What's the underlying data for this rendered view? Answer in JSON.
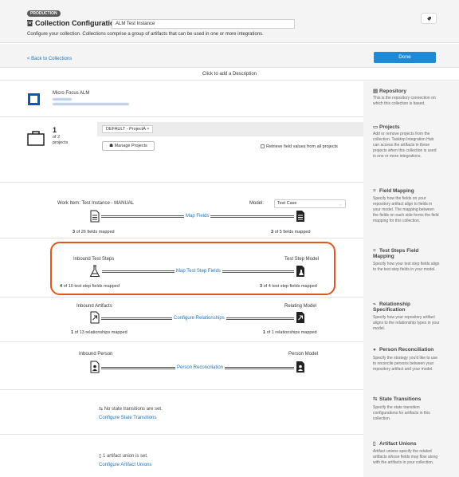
{
  "header": {
    "badge": "PRODUCTION",
    "title": "Collection Configuration",
    "name_value": "ALM Test Instance",
    "subtitle": "Configure your collection. Collections comprise a group of artifacts that can be used in one or more integrations."
  },
  "nav": {
    "back": "< Back to Collections",
    "done": "Done"
  },
  "description": "Click to add a Description",
  "repository": {
    "name": "Micro Focus ALM"
  },
  "projects": {
    "count": "1",
    "of": "of 2",
    "label": "projects",
    "tag": "DEFAULT - ProjectA  ×",
    "manage": "Manage Projects",
    "retrieve": "Retrieve field values from all projects"
  },
  "field_mapping": {
    "left_label": "Work Item: Test Instance - MANUAL",
    "model_label": "Model:",
    "model_value": "Test Case",
    "link": "Map Fields",
    "left_count": "3",
    "left_text": "of 26 fields mapped",
    "right_count": "3",
    "right_text": "of 5 fields mapped"
  },
  "test_steps": {
    "left_label": "Inbound Test Steps",
    "right_label": "Test Step Model",
    "link": "Map Test Step Fields",
    "left_count": "4",
    "left_text": "of 10 test step fields mapped",
    "right_count": "3",
    "right_text": "of 4 test step fields mapped"
  },
  "relationships": {
    "left_label": "Inbound Artifacts",
    "right_label": "Relating Model",
    "link": "Configure Relationships",
    "left_count": "1",
    "left_text": "of 13 relationships mapped",
    "right_count": "1",
    "right_text": "of 1 relationships mapped"
  },
  "person": {
    "left_label": "Inbound Person",
    "right_label": "Person Model",
    "link": "Person Reconciliation"
  },
  "state": {
    "message": "No state transitions are set.",
    "link": "Configure State Transitions"
  },
  "unions": {
    "message": "1 artifact union is set.",
    "link": "Configure Artifact Unions"
  },
  "sidebar": {
    "repository": {
      "title": "Repository",
      "text": "This is the repository connection on which this collection is based."
    },
    "projects": {
      "title": "Projects",
      "text": "Add or remove projects from the collection. Tasktop Integration Hub can access the artifacts in these projects when this collection is used in one or more integrations."
    },
    "field_mapping": {
      "title": "Field Mapping",
      "text": "Specify how the fields on your repository artifact align to fields in your model. The mapping between the fields on each side forms the field mapping for this collection."
    },
    "test_steps": {
      "title": "Test Steps Field Mapping",
      "text": "Specify how your test step fields align to the test step fields in your model."
    },
    "relationship": {
      "title": "Relationship Specification",
      "text": "Specify how your repository artifact aligns to the relationship types in your model."
    },
    "person": {
      "title": "Person Reconciliation",
      "text": "Specify the strategy you'd like to use to reconcile persons between your repository artifact and your model."
    },
    "state": {
      "title": "State Transitions",
      "text": "Specify the state transition configurations for artifacts in this collection."
    },
    "unions": {
      "title": "Artifact Unions",
      "text": "Artifact unions specify the related artifacts whose fields may flow along with the artifacts in your collection."
    }
  },
  "colors": {
    "accent": "#1e8ad6",
    "highlight": "#e0561c",
    "logo": "#0b59b7"
  }
}
